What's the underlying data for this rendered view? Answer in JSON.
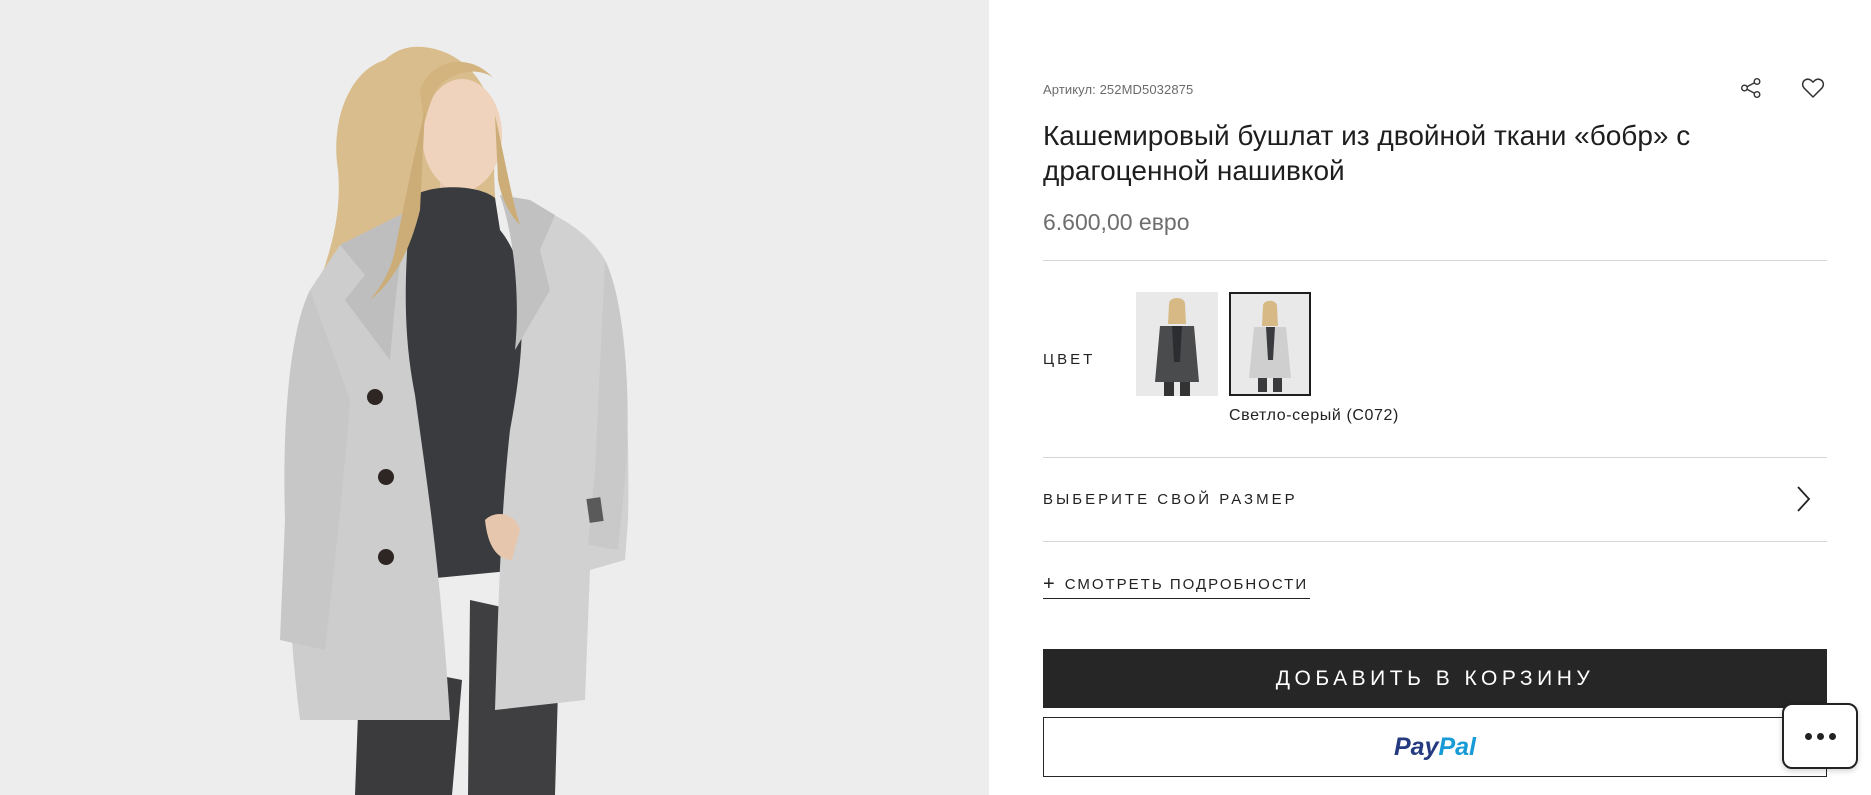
{
  "product": {
    "sku_text": "Артикул: 252MD5032875",
    "title": "Кашемировый бушлат из двойной ткани «бобр» с драгоценной нашивкой",
    "price": "6.600,00 евро"
  },
  "actions": {
    "share_icon": "share-icon",
    "wishlist_icon": "heart-icon"
  },
  "color_section": {
    "label": "ЦВЕТ",
    "swatches": [
      {
        "color": "#4a4a4a",
        "icon": "coat-thumbnail"
      },
      {
        "color": "#cfcfcf",
        "icon": "coat-thumbnail",
        "selected": true
      }
    ],
    "selected_name": "Светло-серый (C072)"
  },
  "size_section": {
    "label": "ВЫБЕРИТЕ СВОЙ РАЗМЕР",
    "icon": "chevron-right-icon"
  },
  "details": {
    "icon": "plus-icon",
    "label": "СМОТРЕТЬ ПОДРОБНОСТИ"
  },
  "buttons": {
    "add_to_cart": "ДОБАВИТЬ В КОРЗИНУ",
    "paypal_pay": "Pay",
    "paypal_pal": "Pal"
  },
  "chat": {
    "icon": "chat-icon"
  },
  "colors": {
    "primary_dark": "#262626",
    "paypal_dark": "#253b80",
    "paypal_light": "#179bd7",
    "image_background": "#ededed"
  }
}
